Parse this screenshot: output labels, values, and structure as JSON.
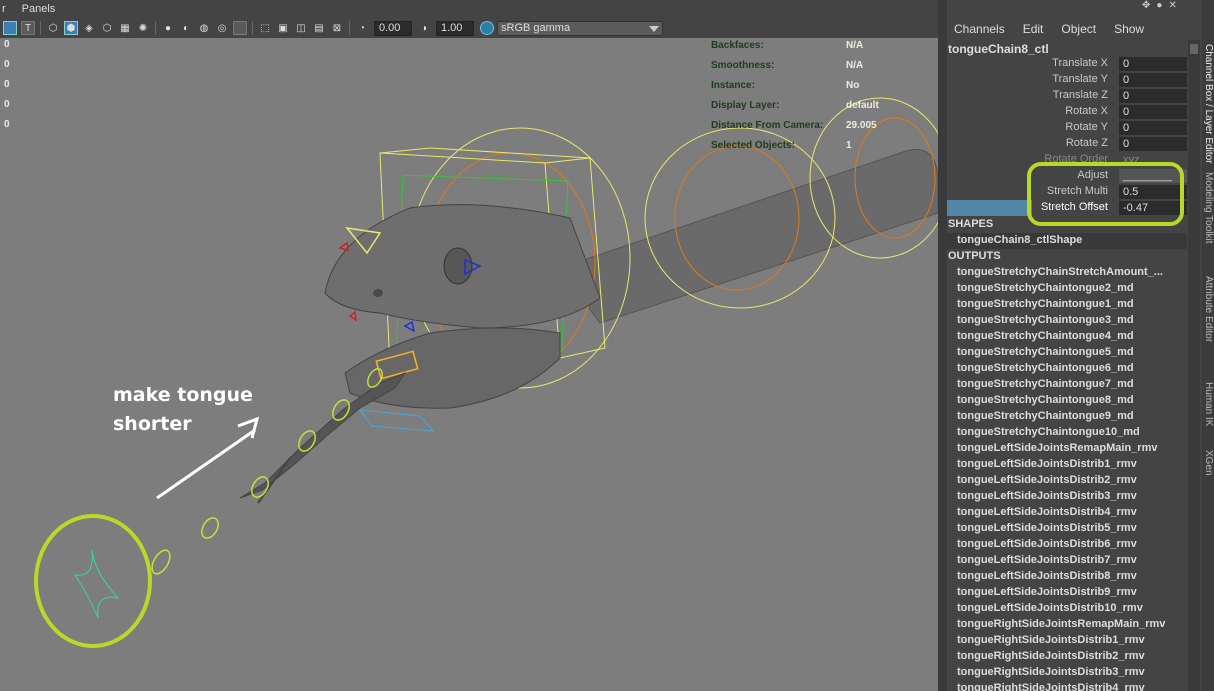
{
  "menubar": {
    "items": [
      "r",
      "Panels"
    ]
  },
  "toolbar": {
    "field_exposure": "0.00",
    "field_gamma": "1.00",
    "colorspace": "sRGB gamma"
  },
  "hud_left": [
    "0",
    "0",
    "0",
    "0",
    "0"
  ],
  "hud_info": [
    {
      "label": "Backfaces:",
      "value": "N/A"
    },
    {
      "label": "Smoothness:",
      "value": "N/A"
    },
    {
      "label": "Instance:",
      "value": "No"
    },
    {
      "label": "Display Layer:",
      "value": "default"
    },
    {
      "label": "Distance From Camera:",
      "value": "29.005"
    },
    {
      "label": "Selected Objects:",
      "value": "1"
    }
  ],
  "annotation": {
    "line1": "make tongue",
    "line2": "shorter"
  },
  "channel_box": {
    "menu": [
      "Channels",
      "Edit",
      "Object",
      "Show"
    ],
    "object_name": "tongueChain8_ctl",
    "attributes": [
      {
        "label": "Translate X",
        "value": "0"
      },
      {
        "label": "Translate Y",
        "value": "0"
      },
      {
        "label": "Translate Z",
        "value": "0"
      },
      {
        "label": "Rotate X",
        "value": "0"
      },
      {
        "label": "Rotate Y",
        "value": "0"
      },
      {
        "label": "Rotate Z",
        "value": "0"
      },
      {
        "label": "Rotate Order",
        "value": "xyz"
      },
      {
        "label": "Adjust",
        "value": "________"
      },
      {
        "label": "Stretch Multi",
        "value": "0.5"
      },
      {
        "label": "Stretch Offset",
        "value": "-0.47"
      }
    ],
    "shapes_header": "SHAPES",
    "shape": "tongueChain8_ctlShape",
    "outputs_header": "OUTPUTS",
    "outputs": [
      "tongueStretchyChainStretchAmount_...",
      "tongueStretchyChaintongue2_md",
      "tongueStretchyChaintongue1_md",
      "tongueStretchyChaintongue3_md",
      "tongueStretchyChaintongue4_md",
      "tongueStretchyChaintongue5_md",
      "tongueStretchyChaintongue6_md",
      "tongueStretchyChaintongue7_md",
      "tongueStretchyChaintongue8_md",
      "tongueStretchyChaintongue9_md",
      "tongueStretchyChaintongue10_md",
      "tongueLeftSideJointsRemapMain_rmv",
      "tongueLeftSideJointsDistrib1_rmv",
      "tongueLeftSideJointsDistrib2_rmv",
      "tongueLeftSideJointsDistrib3_rmv",
      "tongueLeftSideJointsDistrib4_rmv",
      "tongueLeftSideJointsDistrib5_rmv",
      "tongueLeftSideJointsDistrib6_rmv",
      "tongueLeftSideJointsDistrib7_rmv",
      "tongueLeftSideJointsDistrib8_rmv",
      "tongueLeftSideJointsDistrib9_rmv",
      "tongueLeftSideJointsDistrib10_rmv",
      "tongueRightSideJointsRemapMain_rmv",
      "tongueRightSideJointsDistrib1_rmv",
      "tongueRightSideJointsDistrib2_rmv",
      "tongueRightSideJointsDistrib3_rmv",
      "tongueRightSideJointsDistrib4_rmv"
    ]
  },
  "side_tabs": [
    "Channel Box / Layer Editor",
    "Modeling Toolkit",
    "Attribute Editor",
    "Human IK",
    "XGen"
  ],
  "colors": {
    "viewport_bg": "#7d7d7d",
    "highlight": "#b7d928",
    "selection": "#5285a6"
  }
}
